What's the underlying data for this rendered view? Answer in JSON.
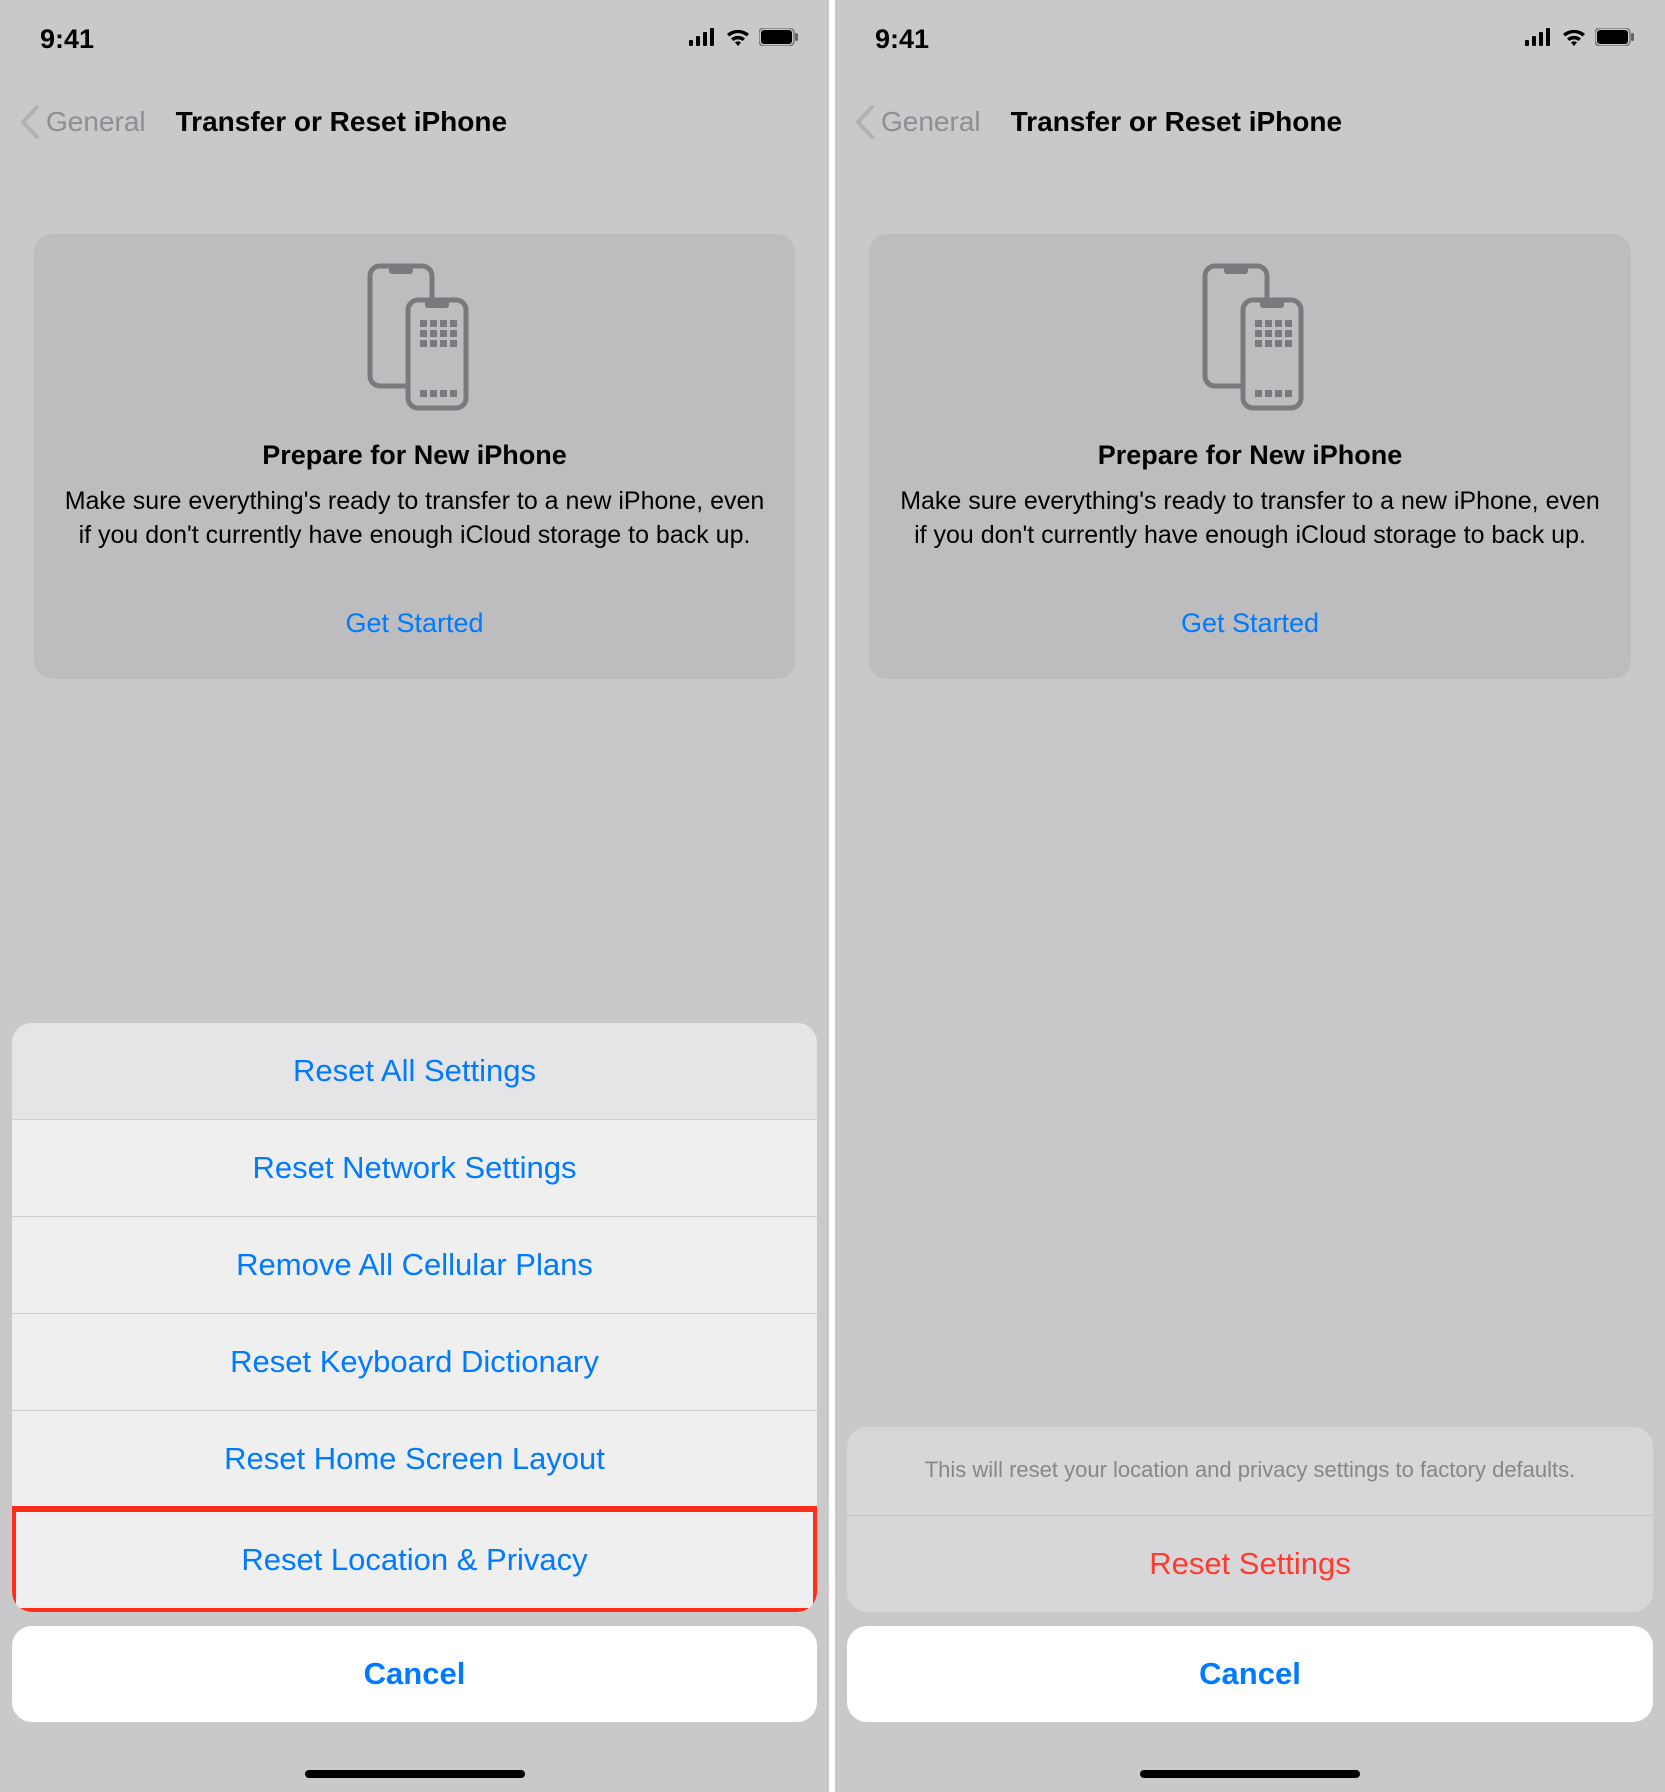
{
  "status": {
    "time": "9:41"
  },
  "nav": {
    "back_label": "General",
    "title": "Transfer or Reset iPhone"
  },
  "prepare": {
    "title": "Prepare for New iPhone",
    "description": "Make sure everything's ready to transfer to a new iPhone, even if you don't currently have enough iCloud storage to back up.",
    "get_started": "Get Started"
  },
  "reset_sheet": {
    "items": [
      "Reset All Settings",
      "Reset Network Settings",
      "Remove All Cellular Plans",
      "Reset Keyboard Dictionary",
      "Reset Home Screen Layout",
      "Reset Location & Privacy"
    ],
    "cancel": "Cancel"
  },
  "confirm_sheet": {
    "message": "This will reset your location and privacy settings to factory defaults.",
    "action": "Reset Settings",
    "cancel": "Cancel"
  }
}
